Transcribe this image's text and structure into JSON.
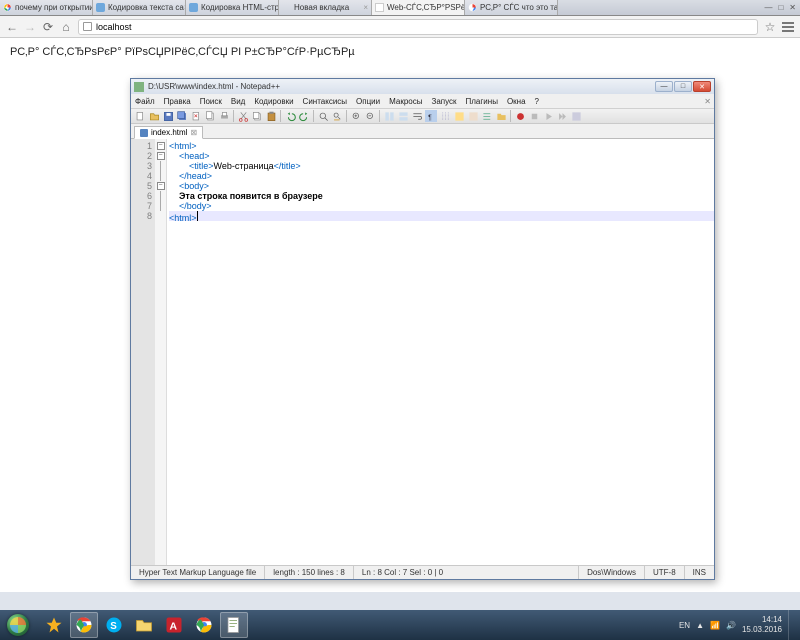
{
  "browser": {
    "tabs": [
      {
        "label": "почему при открытии",
        "favicon": "google"
      },
      {
        "label": "Кодировка текста са",
        "favicon": "page"
      },
      {
        "label": "Кодировка HTML-стр",
        "favicon": "page"
      },
      {
        "label": "Новая вкладка",
        "favicon": "none"
      },
      {
        "label": "Web-СЃС‚СЂР°РЅРёС",
        "favicon": "page",
        "active": true
      },
      {
        "label": "РС‚Р° СЃС что это так",
        "favicon": "google"
      }
    ],
    "address": "localhost",
    "page_text": "РС‚Р° СЃС‚СЂРѕРєР° РїРѕСЏРІРёС‚СЃСЏ РІ Р±СЂР°СѓР·РµСЂРµ"
  },
  "npp": {
    "title": "D:\\USR\\www\\index.html - Notepad++",
    "menu": [
      "Файл",
      "Правка",
      "Поиск",
      "Вид",
      "Кодировки",
      "Синтаксисы",
      "Опции",
      "Макросы",
      "Запуск",
      "Плагины",
      "Окна",
      "?"
    ],
    "filetab": "index.html",
    "code": {
      "l1": "<html>",
      "l2": "    <head>",
      "l3_a": "        <title>",
      "l3_b": "Web-страница",
      "l3_c": "</title>",
      "l4": "    </head>",
      "l5": "    <body>",
      "l6": "    Эта строка появится в браузере",
      "l7": "    </body>",
      "l8": "<html>"
    },
    "status": {
      "lang": "Hyper Text Markup Language file",
      "meta": "length : 150    lines : 8",
      "pos": "Ln : 8    Col : 7    Sel : 0 | 0",
      "eol": "Dos\\Windows",
      "enc": "UTF-8",
      "mode": "INS"
    }
  },
  "taskbar": {
    "lang": "EN",
    "time": "14:14",
    "date": "15.03.2016"
  }
}
